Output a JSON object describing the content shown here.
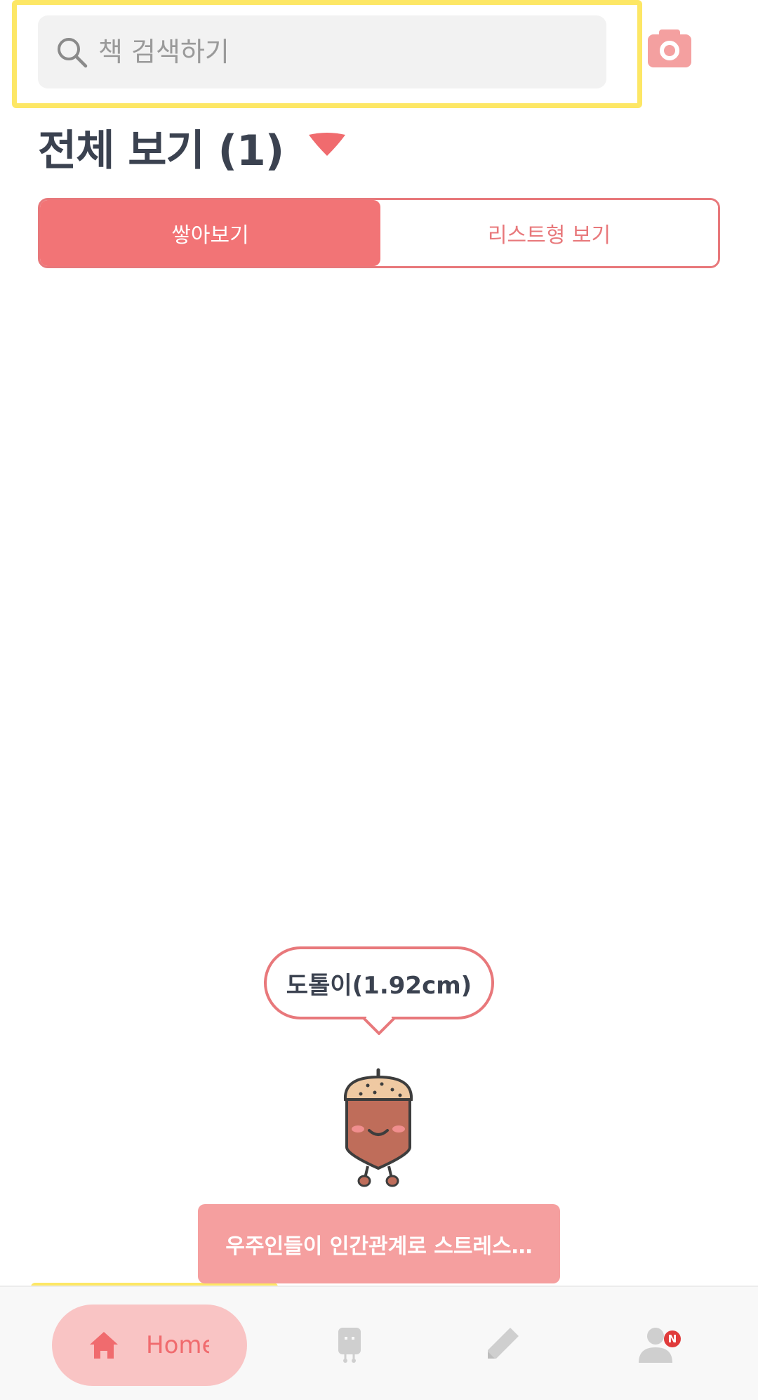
{
  "search": {
    "placeholder": "책 검색하기",
    "value": ""
  },
  "header": {
    "title": "전체 보기 (1)"
  },
  "view_toggle": {
    "stacked_label": "쌓아보기",
    "list_label": "리스트형 보기",
    "selected": "stacked"
  },
  "character": {
    "bubble_text": "도톨이(1.92cm)"
  },
  "book_banner": {
    "text": "우주인들이 인간관계로 스트레스…"
  },
  "bottom_nav": {
    "items": [
      {
        "label": "Home",
        "icon": "home-icon",
        "active": true
      },
      {
        "label": "",
        "icon": "bookshelf-icon",
        "active": false
      },
      {
        "label": "",
        "icon": "pencil-icon",
        "active": false
      },
      {
        "label": "",
        "icon": "profile-icon",
        "active": false,
        "badge": "N"
      }
    ]
  },
  "colors": {
    "accent": "#f27476",
    "accent_light": "#f9c4c4",
    "banner": "#f59f9f",
    "text": "#3b4250",
    "badge": "#e03b3b",
    "highlight": "#fde765"
  }
}
